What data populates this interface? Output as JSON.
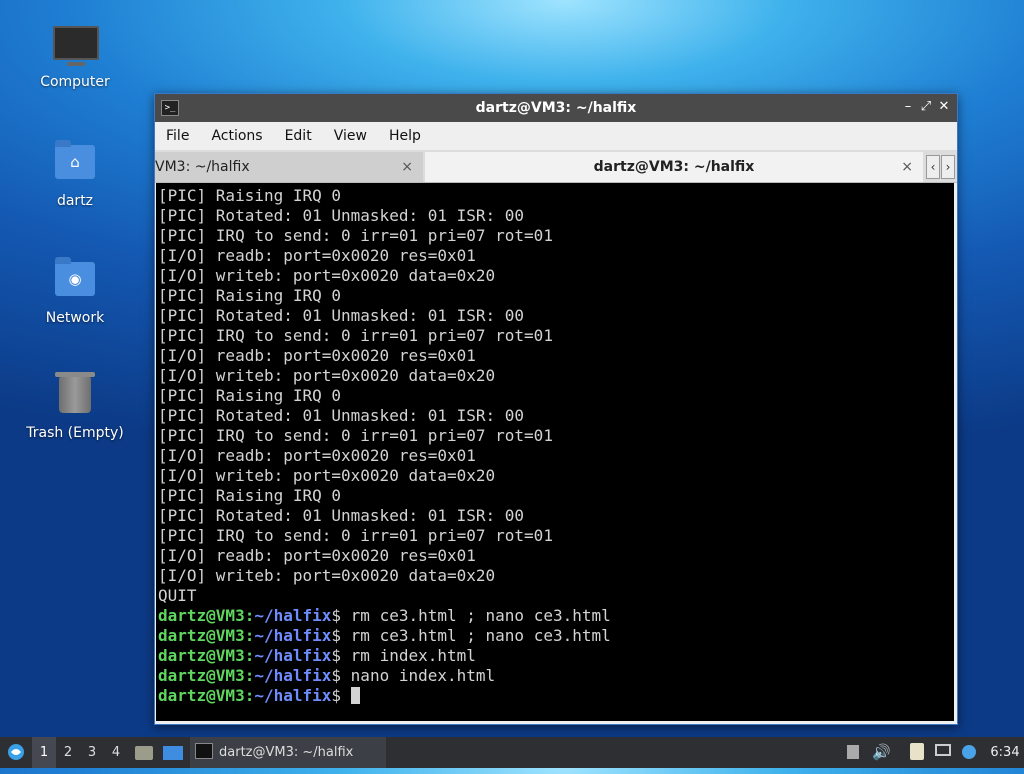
{
  "desktop": {
    "icons": [
      {
        "label": "Computer",
        "icon": "computer-icon"
      },
      {
        "label": "dartz",
        "icon": "home-folder-icon"
      },
      {
        "label": "Network",
        "icon": "network-folder-icon"
      },
      {
        "label": "Trash (Empty)",
        "icon": "trash-icon"
      }
    ]
  },
  "window": {
    "title": "dartz@VM3: ~/halfix",
    "menu": [
      "File",
      "Actions",
      "Edit",
      "View",
      "Help"
    ],
    "tabs": [
      {
        "label": "VM3: ~/halfix",
        "active": false
      },
      {
        "label": "dartz@VM3: ~/halfix",
        "active": true
      }
    ],
    "close_glyph": "×"
  },
  "terminal": {
    "output_lines": [
      "[PIC] Raising IRQ 0",
      "[PIC] Rotated: 01 Unmasked: 01 ISR: 00",
      "[PIC] IRQ to send: 0 irr=01 pri=07 rot=01",
      "[I/O] readb: port=0x0020 res=0x01",
      "[I/O] writeb: port=0x0020 data=0x20",
      "[PIC] Raising IRQ 0",
      "[PIC] Rotated: 01 Unmasked: 01 ISR: 00",
      "[PIC] IRQ to send: 0 irr=01 pri=07 rot=01",
      "[I/O] readb: port=0x0020 res=0x01",
      "[I/O] writeb: port=0x0020 data=0x20",
      "[PIC] Raising IRQ 0",
      "[PIC] Rotated: 01 Unmasked: 01 ISR: 00",
      "[PIC] IRQ to send: 0 irr=01 pri=07 rot=01",
      "[I/O] readb: port=0x0020 res=0x01",
      "[I/O] writeb: port=0x0020 data=0x20",
      "[PIC] Raising IRQ 0",
      "[PIC] Rotated: 01 Unmasked: 01 ISR: 00",
      "[PIC] IRQ to send: 0 irr=01 pri=07 rot=01",
      "[I/O] readb: port=0x0020 res=0x01",
      "[I/O] writeb: port=0x0020 data=0x20",
      "QUIT"
    ],
    "prompt_user": "dartz@VM3",
    "prompt_path": "~/halfix",
    "commands": [
      "rm ce3.html ; nano ce3.html",
      "rm ce3.html ; nano ce3.html",
      "rm index.html",
      "nano index.html",
      ""
    ]
  },
  "taskbar": {
    "workspaces": [
      "1",
      "2",
      "3",
      "4"
    ],
    "active_workspace": "1",
    "task_label": "dartz@VM3: ~/halfix",
    "clock": "6:34"
  },
  "colors": {
    "prompt_user": "#5fd75f",
    "prompt_path": "#6f8cff",
    "titlebar": "#4a4a4a",
    "taskbar": "#2d2f33"
  }
}
